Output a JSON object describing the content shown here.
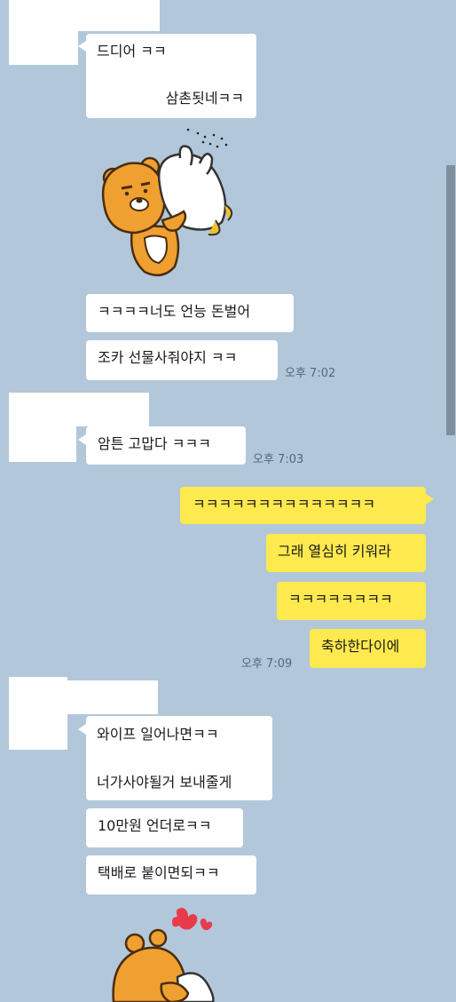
{
  "colors": {
    "background": "#b2c7da",
    "incoming_bubble": "#ffffff",
    "outgoing_bubble": "#fee94e",
    "timestamp": "#556677"
  },
  "sticker_icons": [
    "bear-hugging-bunny-sticker",
    "bear-with-hearts-sticker"
  ],
  "messages": {
    "g1_line1": "드디어 ㅋㅋ",
    "g1_line2": "삼촌됫네ㅋㅋ",
    "g2_msg1": "ㅋㅋㅋㅋ너도 언능 돈벌어",
    "g2_msg2": "조카 선물사줘야지 ㅋㅋ",
    "g2_time": "오후 7:02",
    "g3_msg1": "암튼 고맙다 ㅋㅋㅋ",
    "g3_time": "오후 7:03",
    "me_msg1": "ㅋㅋㅋㅋㅋㅋㅋㅋㅋㅋㅋㅋㅋㅋ",
    "me_msg2": "그래 열심히 키워라",
    "me_msg3": "ㅋㅋㅋㅋㅋㅋㅋㅋ",
    "me_msg4": "축하한다이에",
    "me_time": "오후 7:09",
    "g4_line1": "와이프 일어나면ㅋㅋ",
    "g4_line2": "너가사야될거 보내줄게",
    "g4_msg2": "10만원 언더로ㅋㅋ",
    "g4_msg3": "택배로 붙이면되ㅋㅋ"
  }
}
